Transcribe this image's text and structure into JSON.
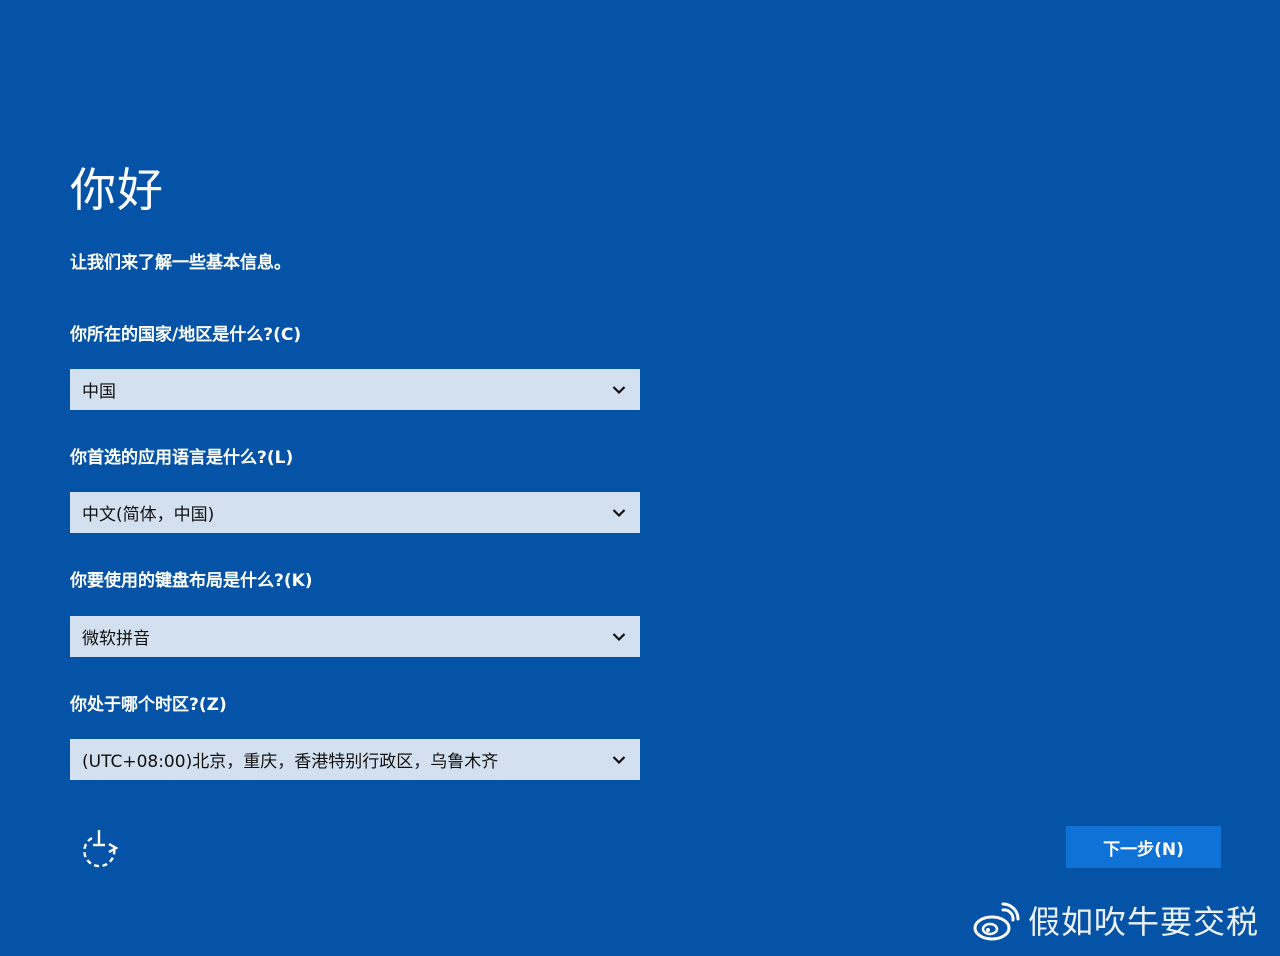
{
  "header": {
    "title": "你好",
    "subtitle": "让我们来了解一些基本信息。"
  },
  "fields": [
    {
      "label": "你所在的国家/地区是什么?(C)",
      "value": "中国"
    },
    {
      "label": "你首选的应用语言是什么?(L)",
      "value": "中文(简体，中国)"
    },
    {
      "label": "你要使用的键盘布局是什么?(K)",
      "value": "微软拼音"
    },
    {
      "label": "你处于哪个时区?(Z)",
      "value": "(UTC+08:00)北京，重庆，香港特别行政区，乌鲁木齐"
    }
  ],
  "footer": {
    "accessibility_icon": "ease-of-access-icon",
    "next_label": "下一步(N)"
  },
  "watermark": {
    "icon": "weibo-logo",
    "text": "假如吹牛要交税"
  },
  "colors": {
    "background": "#0553a6",
    "select_background": "#d3e0ef",
    "button_background": "#0f72d6"
  }
}
